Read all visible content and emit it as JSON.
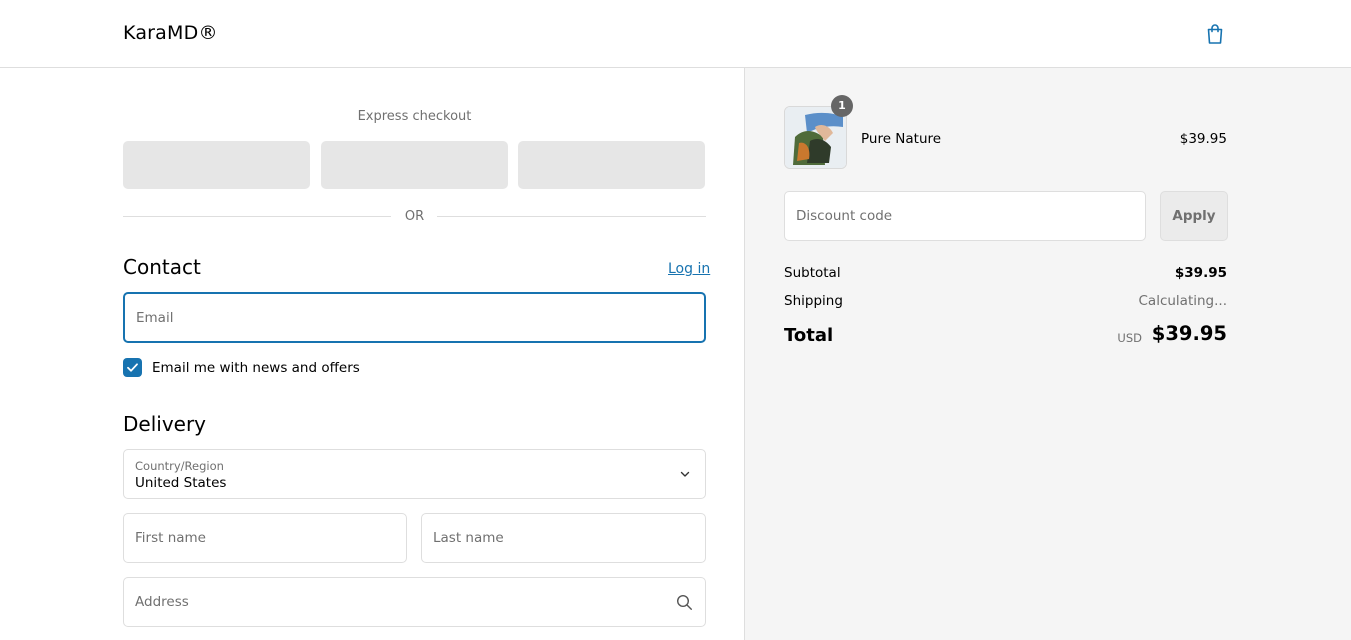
{
  "header": {
    "brand": "KaraMD®",
    "cart_icon": "shopping-bag-icon",
    "accent_color": "#1773b0"
  },
  "express": {
    "title": "Express checkout",
    "divider_text": "OR"
  },
  "contact": {
    "title": "Contact",
    "login_label": "Log in",
    "email_placeholder": "Email",
    "email_value": "",
    "newsletter_checked": true,
    "newsletter_label": "Email me with news and offers"
  },
  "delivery": {
    "title": "Delivery",
    "country_label": "Country/Region",
    "country_value": "United States",
    "first_name_placeholder": "First name",
    "last_name_placeholder": "Last name",
    "address_placeholder": "Address"
  },
  "summary": {
    "product": {
      "name": "Pure Nature",
      "price": "$39.95",
      "quantity": "1"
    },
    "discount_placeholder": "Discount code",
    "apply_label": "Apply",
    "subtotal_label": "Subtotal",
    "subtotal_value": "$39.95",
    "shipping_label": "Shipping",
    "shipping_value": "Calculating...",
    "total_label": "Total",
    "total_currency": "USD",
    "total_value": "$39.95"
  }
}
